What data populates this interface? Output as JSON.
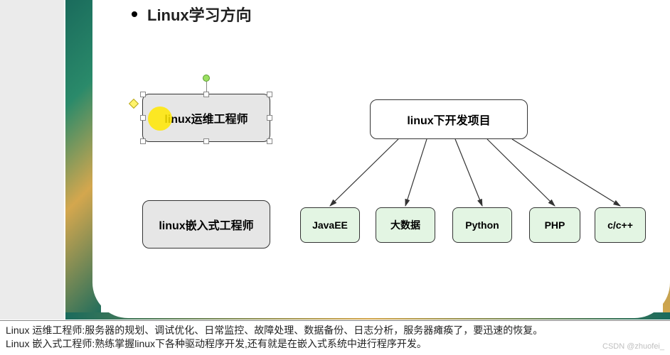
{
  "heading": "Linux学习方向",
  "boxes": {
    "ops_engineer": "linux运维工程师",
    "embedded_engineer": "linux嵌入式工程师",
    "dev_projects": "linux下开发项目"
  },
  "children": [
    "JavaEE",
    "大数据",
    "Python",
    "PHP",
    "c/c++"
  ],
  "footer": {
    "line1": "Linux 运维工程师:服务器的规划、调试优化、日常监控、故障处理、数据备份、日志分析，服务器瘫痪了，要迅速的恢复。",
    "line2": "Linux 嵌入式工程师:熟练掌握linux下各种驱动程序开发,还有就是在嵌入式系统中进行程序开发。"
  },
  "watermark": "CSDN @zhuofei_"
}
